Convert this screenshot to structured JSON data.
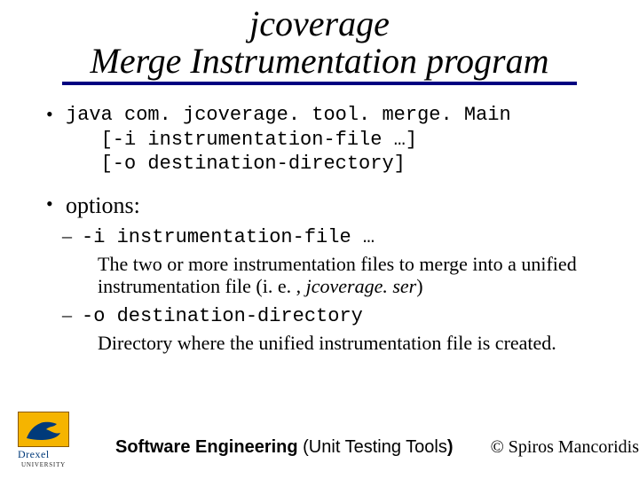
{
  "title": {
    "line1": "jcoverage",
    "line2": "Merge Instrumentation program"
  },
  "invoke": {
    "l1": "java com. jcoverage. tool. merge. Main",
    "l2": "   [-i instrumentation-file …]",
    "l3": "   [-o destination-directory]"
  },
  "options_label": "options:",
  "opt_i": {
    "flag": "-i instrumentation-file …",
    "desc_a": "The two or more instrumentation files to merge into a unified instrumentation file (i. e. , ",
    "desc_b": "jcoverage. ser",
    "desc_c": ")"
  },
  "opt_o": {
    "flag": "-o destination-directory",
    "desc": "Directory where the unified instrumentation file is created."
  },
  "footer": {
    "logo_name": "Drexel",
    "logo_sub": "UNIVERSITY",
    "left_bold1": "Software Engineering",
    "left_plain": " (Unit Testing Tools",
    "left_bold2": ")",
    "right": "© Spiros Mancoridis"
  }
}
